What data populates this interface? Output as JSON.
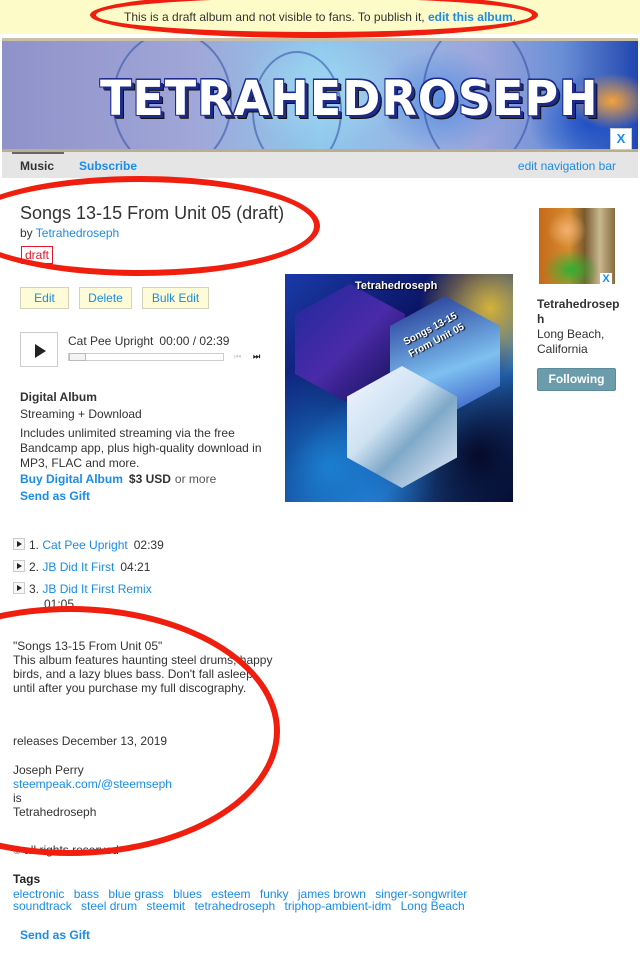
{
  "draft_banner": {
    "text": "This is a draft album and not visible to fans. To publish it, ",
    "link": "edit this album",
    "suffix": "."
  },
  "header": {
    "banner_title": "TETRAHEDROSEPH",
    "close_label": "X"
  },
  "nav": {
    "items": [
      {
        "label": "Music",
        "active": true
      },
      {
        "label": "Subscribe",
        "active": false
      }
    ],
    "edit_link": "edit navigation bar"
  },
  "album": {
    "title": "Songs 13-15 From Unit 05 (draft)",
    "by_prefix": "by ",
    "artist": "Tetrahedroseph",
    "status_tag": "draft"
  },
  "actions": {
    "edit": "Edit",
    "delete": "Delete",
    "bulk_edit": "Bulk Edit"
  },
  "player": {
    "track_title": "Cat Pee Upright",
    "time": "00:00 / 02:39",
    "progress_percent": 0,
    "prev_icon": "⏮",
    "next_icon": "⏭"
  },
  "digital_album": {
    "title": "Digital Album",
    "subtitle": "Streaming + Download",
    "description": "Includes unlimited streaming via the free Bandcamp app, plus high-quality download in MP3, FLAC and more.",
    "buy_label": "Buy Digital Album",
    "price": "$3 USD",
    "price_suffix": "or more",
    "gift_label": "Send as Gift"
  },
  "album_art": {
    "artist_text": "Tetrahedroseph",
    "title_line1": "Songs 13-15",
    "title_line2": "From Unit 05"
  },
  "artist_panel": {
    "avatar_close": "X",
    "name": "Tetrahedroseph",
    "location": "Long Beach, California",
    "follow_label": "Following",
    "follow_color": "#6b9cab"
  },
  "tracks": [
    {
      "num": "1.",
      "title": "Cat Pee Upright",
      "duration": "02:39"
    },
    {
      "num": "2.",
      "title": "JB Did It First",
      "duration": "04:21"
    },
    {
      "num": "3.",
      "title": "JB Did It First Remix",
      "duration": "01:05"
    }
  ],
  "about": {
    "quote_title": "\"Songs 13-15 From Unit 05\"",
    "body": "This album features haunting steel drums, happy birds, and a lazy blues bass. Don't fall asleep until after you purchase my full discography.",
    "release": "releases December 13, 2019"
  },
  "credits": {
    "name": "Joseph Perry",
    "link": "steempeak.com/@steemseph",
    "is": "is",
    "alias": "Tetrahedroseph"
  },
  "rights": {
    "symbol": "©",
    "text": "all rights reserved"
  },
  "tags": {
    "title": "Tags",
    "items": [
      "electronic",
      "bass",
      "blue grass",
      "blues",
      "esteem",
      "funky",
      "james brown",
      "singer-songwriter",
      "soundtrack",
      "steel drum",
      "steemit",
      "tetrahedroseph",
      "triphop-ambient-idm",
      "Long Beach"
    ]
  },
  "footer": {
    "gift_label": "Send as Gift"
  },
  "colors": {
    "link": "#1a8ce8",
    "draft_banner_bg": "#fdfbc7",
    "draft_tag": "#e1182b",
    "annotation": "#f01e0e",
    "nav_bg": "#e5e5e5"
  }
}
